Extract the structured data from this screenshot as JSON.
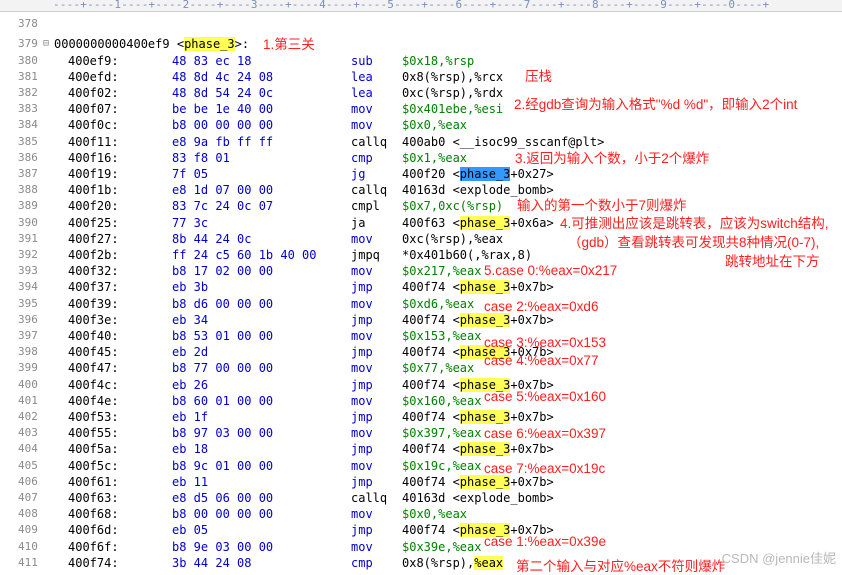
{
  "ruler": "----+----1----+----2----+----3----+----4----+----5----+----6----+----7----+----8----+----9----+----0----+",
  "header": {
    "line_378": "378",
    "line_379": "379",
    "fold": "⊟",
    "label_addr": "0000000000400ef9 ",
    "label_open": "<",
    "label_name": "phase_3",
    "label_close": ">:"
  },
  "rows": [
    {
      "n": "380",
      "addr": "400ef9:",
      "b": "48 83 ec 18",
      "m": "sub",
      "o": "$0x18,%rsp"
    },
    {
      "n": "381",
      "addr": "400efd:",
      "b": "48 8d 4c 24 08",
      "m": "lea",
      "o": "0x8(%rsp),%rcx"
    },
    {
      "n": "382",
      "addr": "400f02:",
      "b": "48 8d 54 24 0c",
      "m": "lea",
      "o": "0xc(%rsp),%rdx"
    },
    {
      "n": "383",
      "addr": "400f07:",
      "b": "be be 1e 40 00",
      "m": "mov",
      "o": "$0x401ebe,%esi"
    },
    {
      "n": "384",
      "addr": "400f0c:",
      "b": "b8 00 00 00 00",
      "m": "mov",
      "o": "$0x0,%eax"
    },
    {
      "n": "385",
      "addr": "400f11:",
      "b": "e8 9a fb ff ff",
      "m": "callq",
      "o": "400ab0 <__isoc99_sscanf@plt>"
    },
    {
      "n": "386",
      "addr": "400f16:",
      "b": "83 f8 01",
      "m": "cmp",
      "o": "$0x1,%eax"
    },
    {
      "n": "387",
      "addr": "400f19:",
      "b": "7f 05",
      "m": "jg",
      "o": "400f20 <",
      "o_hl": "phase_3",
      "o_tail": "+0x27>"
    },
    {
      "n": "388",
      "addr": "400f1b:",
      "b": "e8 1d 07 00 00",
      "m": "callq",
      "o": "40163d <explode_bomb>"
    },
    {
      "n": "389",
      "addr": "400f20:",
      "b": "83 7c 24 0c 07",
      "m": "cmpl",
      "o": "$0x7,0xc(%rsp)"
    },
    {
      "n": "390",
      "addr": "400f25:",
      "b": "77 3c",
      "m": "ja",
      "o": "400f63 <",
      "o_hl": "phase_3",
      "o_tail": "+0x6a>"
    },
    {
      "n": "391",
      "addr": "400f27:",
      "b": "8b 44 24 0c",
      "m": "mov",
      "o": "0xc(%rsp),%eax"
    },
    {
      "n": "392",
      "addr": "400f2b:",
      "b": "ff 24 c5 60 1b 40 00",
      "m": "jmpq",
      "o": "*0x401b60(,%rax,8)"
    },
    {
      "n": "393",
      "addr": "400f32:",
      "b": "b8 17 02 00 00",
      "m": "mov",
      "o": "$0x217,%eax"
    },
    {
      "n": "394",
      "addr": "400f37:",
      "b": "eb 3b",
      "m": "jmp",
      "o": "400f74 <",
      "o_hl": "phase_3",
      "o_tail": "+0x7b>"
    },
    {
      "n": "395",
      "addr": "400f39:",
      "b": "b8 d6 00 00 00",
      "m": "mov",
      "o": "$0xd6,%eax"
    },
    {
      "n": "396",
      "addr": "400f3e:",
      "b": "eb 34",
      "m": "jmp",
      "o": "400f74 <",
      "o_hl": "phase_3",
      "o_tail": "+0x7b>"
    },
    {
      "n": "397",
      "addr": "400f40:",
      "b": "b8 53 01 00 00",
      "m": "mov",
      "o": "$0x153,%eax"
    },
    {
      "n": "398",
      "addr": "400f45:",
      "b": "eb 2d",
      "m": "jmp",
      "o": "400f74 <",
      "o_hl": "phase_3",
      "o_tail": "+0x7b>"
    },
    {
      "n": "399",
      "addr": "400f47:",
      "b": "b8 77 00 00 00",
      "m": "mov",
      "o": "$0x77,%eax"
    },
    {
      "n": "400",
      "addr": "400f4c:",
      "b": "eb 26",
      "m": "jmp",
      "o": "400f74 <",
      "o_hl": "phase_3",
      "o_tail": "+0x7b>"
    },
    {
      "n": "401",
      "addr": "400f4e:",
      "b": "b8 60 01 00 00",
      "m": "mov",
      "o": "$0x160,%eax"
    },
    {
      "n": "402",
      "addr": "400f53:",
      "b": "eb 1f",
      "m": "jmp",
      "o": "400f74 <",
      "o_hl": "phase_3",
      "o_tail": "+0x7b>"
    },
    {
      "n": "403",
      "addr": "400f55:",
      "b": "b8 97 03 00 00",
      "m": "mov",
      "o": "$0x397,%eax"
    },
    {
      "n": "404",
      "addr": "400f5a:",
      "b": "eb 18",
      "m": "jmp",
      "o": "400f74 <",
      "o_hl": "phase_3",
      "o_tail": "+0x7b>"
    },
    {
      "n": "405",
      "addr": "400f5c:",
      "b": "b8 9c 01 00 00",
      "m": "mov",
      "o": "$0x19c,%eax"
    },
    {
      "n": "406",
      "addr": "400f61:",
      "b": "eb 11",
      "m": "jmp",
      "o": "400f74 <",
      "o_hl": "phase_3",
      "o_tail": "+0x7b>"
    },
    {
      "n": "407",
      "addr": "400f63:",
      "b": "e8 d5 06 00 00",
      "m": "callq",
      "o": "40163d <explode_bomb>"
    },
    {
      "n": "408",
      "addr": "400f68:",
      "b": "b8 00 00 00 00",
      "m": "mov",
      "o": "$0x0,%eax"
    },
    {
      "n": "409",
      "addr": "400f6d:",
      "b": "eb 05",
      "m": "jmp",
      "o": "400f74 <",
      "o_hl": "phase_3",
      "o_tail": "+0x7b>"
    },
    {
      "n": "410",
      "addr": "400f6f:",
      "b": "b8 9e 03 00 00",
      "m": "mov",
      "o": "$0x39e,%eax"
    },
    {
      "n": "411",
      "addr": "400f74:",
      "b": "3b 44 24 08",
      "m": "cmp",
      "o": "0x8(%rsp),",
      "o_hl": "%eax",
      "o_tail": ""
    }
  ],
  "annotations": {
    "a1": "1.第三关",
    "a2": "压栈",
    "a3": "2.经gdb查询为输入格式\"%d %d\"，即输入2个int",
    "a4": "3.返回为输入个数，小于2个爆炸",
    "a5": "输入的第一个数小于7则爆炸",
    "a6": "4.可推测出应该是跳转表，应该为switch结构,",
    "a7": "（gdb）查看跳转表可发现共8种情况(0-7),",
    "a8": "跳转地址在下方",
    "c0": "5.case 0:%eax=0x217",
    "c2": "case 2:%eax=0xd6",
    "c3": "case 3:%eax=0x153",
    "c4": "case 4:%eax=0x77",
    "c5": "case 5:%eax=0x160",
    "c6": "case 6:%eax=0x397",
    "c7": "case 7:%eax=0x19c",
    "c1": "case 1:%eax=0x39e",
    "last": "第二个输入与对应%eax不符则爆炸"
  },
  "watermark": "CSDN @jennie佳妮"
}
